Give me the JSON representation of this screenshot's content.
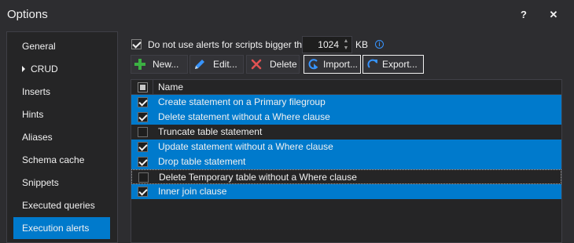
{
  "window": {
    "title": "Options",
    "help_label": "?",
    "close_label": "✕"
  },
  "sidebar": {
    "items": [
      {
        "label": "General",
        "selected": false
      },
      {
        "label": "CRUD",
        "selected": false,
        "expandable": true
      },
      {
        "label": "Inserts",
        "selected": false
      },
      {
        "label": "Hints",
        "selected": false
      },
      {
        "label": "Aliases",
        "selected": false
      },
      {
        "label": "Schema cache",
        "selected": false
      },
      {
        "label": "Snippets",
        "selected": false
      },
      {
        "label": "Executed queries",
        "selected": false
      },
      {
        "label": "Execution alerts",
        "selected": true
      }
    ]
  },
  "options": {
    "skip_large_label": "Do not use alerts for scripts bigger than",
    "skip_large_checked": true,
    "size_value": "1024",
    "size_unit": "KB",
    "info_glyph": "i"
  },
  "toolbar": {
    "new_label": "New...",
    "edit_label": "Edit...",
    "delete_label": "Delete",
    "import_label": "Import...",
    "export_label": "Export..."
  },
  "grid": {
    "header": "Name",
    "rows": [
      {
        "name": "Create statement on a Primary filegroup",
        "checked": true,
        "selected": true
      },
      {
        "name": "Delete statement without a Where clause",
        "checked": true,
        "selected": true
      },
      {
        "name": "Truncate table statement",
        "checked": false,
        "selected": false
      },
      {
        "name": "Update statement without a Where clause",
        "checked": true,
        "selected": true
      },
      {
        "name": "Drop table statement",
        "checked": true,
        "selected": true
      },
      {
        "name": "Delete Temporary table without a Where clause",
        "checked": false,
        "selected": false,
        "focused": true
      },
      {
        "name": "Inner join clause",
        "checked": true,
        "selected": true
      }
    ]
  },
  "colors": {
    "accent": "#007acc",
    "background": "#2d2d30",
    "panel": "#252526",
    "text": "#f1f1f1",
    "add_icon": "#3cb043",
    "edit_icon": "#3794ff",
    "delete_icon": "#e05252"
  },
  "icons": {
    "new": "plus-icon",
    "edit": "pencil-icon",
    "delete": "x-icon",
    "import": "import-icon",
    "export": "export-icon",
    "info": "info-icon"
  }
}
